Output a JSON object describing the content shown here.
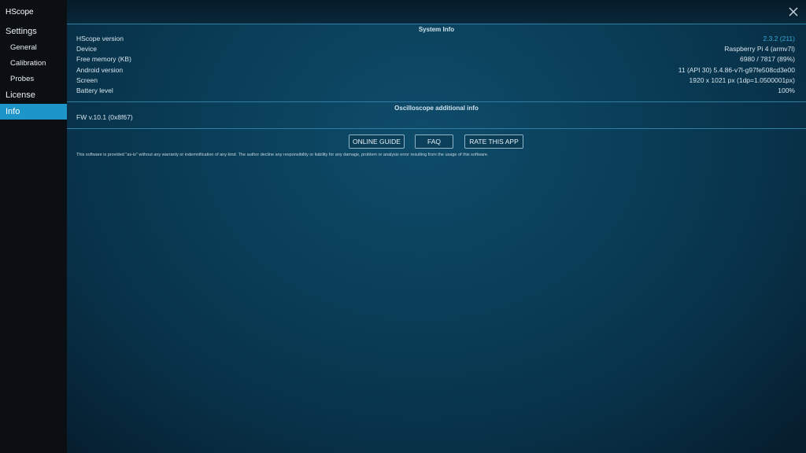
{
  "sidebar": {
    "app_title": "HScope",
    "items": [
      {
        "label": "Settings"
      },
      {
        "label": "General"
      },
      {
        "label": "Calibration"
      },
      {
        "label": "Probes"
      },
      {
        "label": "License"
      },
      {
        "label": "Info"
      }
    ],
    "active_item": "Info"
  },
  "system_info": {
    "title": "System Info",
    "rows": [
      {
        "label": "HScope version",
        "value": "2.3.2 (211)"
      },
      {
        "label": "Device",
        "value": "Raspberry Pi 4 (armv7l)"
      },
      {
        "label": "Free memory (KB)",
        "value": "6980 / 7817 (89%)"
      },
      {
        "label": "Android version",
        "value": "11 (API 30) 5.4.86-v7l-g97fe508cd3e00"
      },
      {
        "label": "Screen",
        "value": "1920 x 1021 px (1dp=1.0500001px)"
      },
      {
        "label": "Battery level",
        "value": "100%"
      }
    ]
  },
  "oscilloscope_info": {
    "title": "Oscilloscope additional info",
    "firmware": "FW v.10.1 (0x8f67)"
  },
  "buttons": {
    "online_guide": "ONLINE GUIDE",
    "faq": "FAQ",
    "rate_app": "RATE THIS APP"
  },
  "disclaimer": "This software is provided \"as-is\" without any warranty or indemnification of any kind. The author decline any responsibility or liability for any damage, problem or analysis error resulting from the usage of this software.",
  "colors": {
    "accent": "#1e95c9",
    "link": "#3aa7d8",
    "background": "#0a3e58"
  },
  "icons": {
    "close": "close-icon"
  }
}
